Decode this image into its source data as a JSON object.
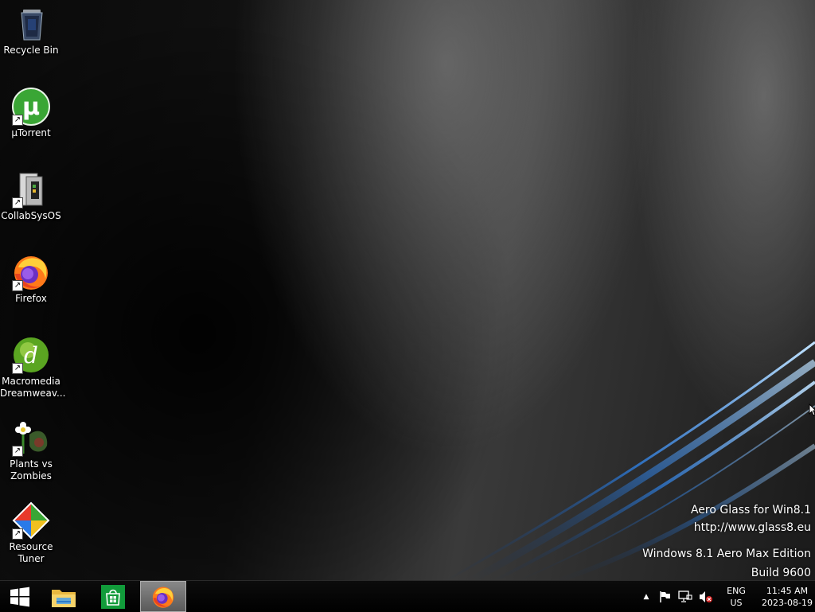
{
  "desktop": {
    "icons": [
      {
        "name": "recycle-bin",
        "label": "Recycle Bin"
      },
      {
        "name": "utorrent",
        "label": "µTorrent"
      },
      {
        "name": "collabsysos",
        "label": "CollabSysOS"
      },
      {
        "name": "firefox",
        "label": "Firefox"
      },
      {
        "name": "dreamweaver",
        "label_line1": "Macromedia",
        "label_line2": "Dreamweav..."
      },
      {
        "name": "plants-vs-zombies",
        "label_line1": "Plants vs",
        "label_line2": "Zombies"
      },
      {
        "name": "resource-tuner",
        "label_line1": "Resource",
        "label_line2": "Tuner"
      }
    ]
  },
  "watermark": {
    "line1": "Aero Glass for Win8.1",
    "line2": "http://www.glass8.eu",
    "line3": "Windows 8.1 Aero Max Edition",
    "line4": "Build 9600"
  },
  "taskbar": {
    "pinned": [
      {
        "name": "start",
        "icon": "windows-logo-icon"
      },
      {
        "name": "file-explorer",
        "icon": "folder-icon"
      },
      {
        "name": "store",
        "icon": "store-icon"
      },
      {
        "name": "firefox",
        "icon": "firefox-icon",
        "active": true
      }
    ],
    "tray": {
      "language_line1": "ENG",
      "language_line2": "US",
      "time": "11:45 AM",
      "date": "2023-08-19"
    }
  },
  "colors": {
    "accent_blue": "#3a8ee6",
    "utorrent_green": "#3aa635",
    "store_green": "#119b3a",
    "firefox_orange": "#ff7a1a"
  }
}
